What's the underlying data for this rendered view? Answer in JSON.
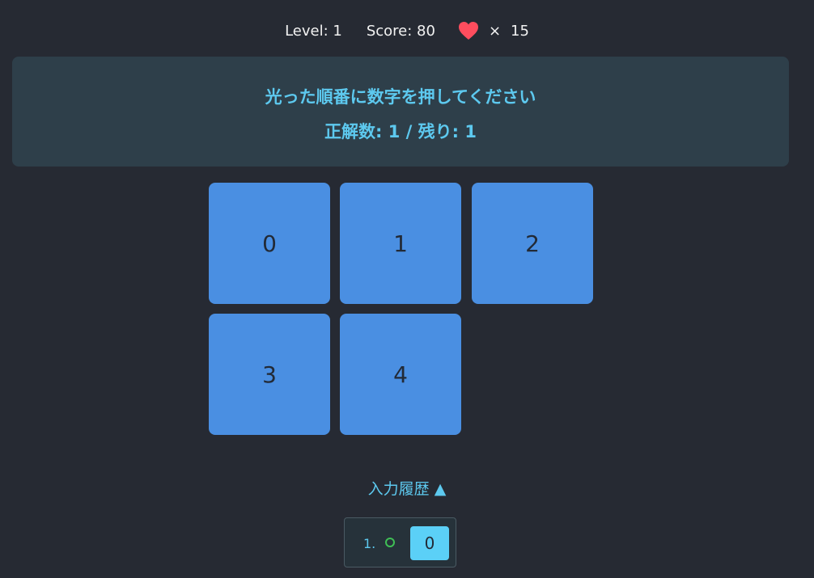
{
  "hud": {
    "level_label": "Level: 1",
    "score_label": "Score: 80",
    "lives_times": "×",
    "lives_count": "15",
    "heart_color": "#ff4d5e"
  },
  "panel": {
    "instruction": "光った順番に数字を押してください",
    "progress": "正解数: 1 / 残り: 1"
  },
  "tiles": [
    "0",
    "1",
    "2",
    "3",
    "4"
  ],
  "history": {
    "toggle_label": "入力履歴 ▲",
    "entries": [
      {
        "index": "1.",
        "result": "correct",
        "value": "0"
      }
    ]
  },
  "colors": {
    "background": "#262a33",
    "panel": "#2e3f4a",
    "accent": "#5dc9ef",
    "tile": "#4a8fe2",
    "correct": "#3fbf55"
  }
}
